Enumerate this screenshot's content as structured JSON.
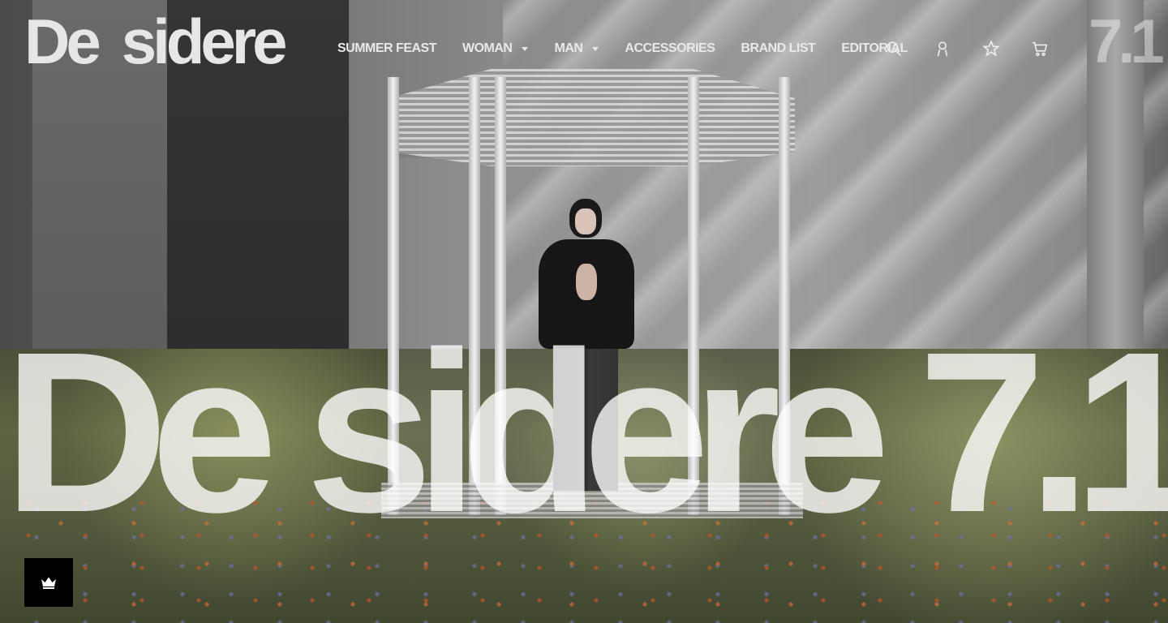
{
  "brand": {
    "logo_left": "De",
    "logo_right": "sidere",
    "edition": "7.1"
  },
  "nav": {
    "items": [
      {
        "label": "SUMMER FEAST",
        "has_dropdown": false
      },
      {
        "label": "WOMAN",
        "has_dropdown": true
      },
      {
        "label": "MAN",
        "has_dropdown": true
      },
      {
        "label": "ACCESSORIES",
        "has_dropdown": false
      },
      {
        "label": "BRAND LIST",
        "has_dropdown": false
      },
      {
        "label": "EDITORIAL",
        "has_dropdown": false
      }
    ]
  },
  "header_icons": [
    "search-icon",
    "user-icon",
    "star-icon",
    "cart-icon"
  ],
  "hero": {
    "title": "De sidere 7.1"
  },
  "badge": {
    "icon": "crown-icon"
  },
  "colors": {
    "text_light": "#e9e9e9",
    "badge_bg": "#000000"
  }
}
